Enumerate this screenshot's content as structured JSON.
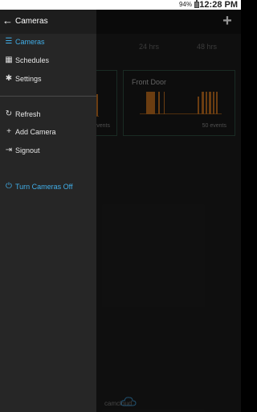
{
  "status_bar": {
    "battery": "94%",
    "time": "12:28 PM"
  },
  "drawer": {
    "title": "Cameras",
    "items": [
      {
        "label": "Cameras",
        "icon": "list-icon",
        "glyph": "☰"
      },
      {
        "label": "Schedules",
        "icon": "calendar-icon",
        "glyph": "▦"
      },
      {
        "label": "Settings",
        "icon": "gear-icon",
        "glyph": "✱"
      }
    ],
    "items2": [
      {
        "label": "Refresh",
        "icon": "refresh-icon",
        "glyph": "↻"
      },
      {
        "label": "Add Camera",
        "icon": "plus-icon",
        "glyph": "+"
      },
      {
        "label": "Signout",
        "icon": "signout-icon",
        "glyph": "⇥"
      }
    ],
    "turn_off": {
      "label": "Turn Cameras Off",
      "icon": "power-icon",
      "glyph": "⏻"
    }
  },
  "timeline": {
    "labels": [
      "s",
      "24 hrs",
      "48 hrs"
    ]
  },
  "cameras": [
    {
      "name": "",
      "events": "events"
    },
    {
      "name": "Front Door",
      "events": "50 events"
    }
  ],
  "logo": {
    "text": "camcloud"
  },
  "colors": {
    "accent": "#41aee8",
    "event_bar": "#b86a1e",
    "card_border": "#2c4a3e"
  }
}
